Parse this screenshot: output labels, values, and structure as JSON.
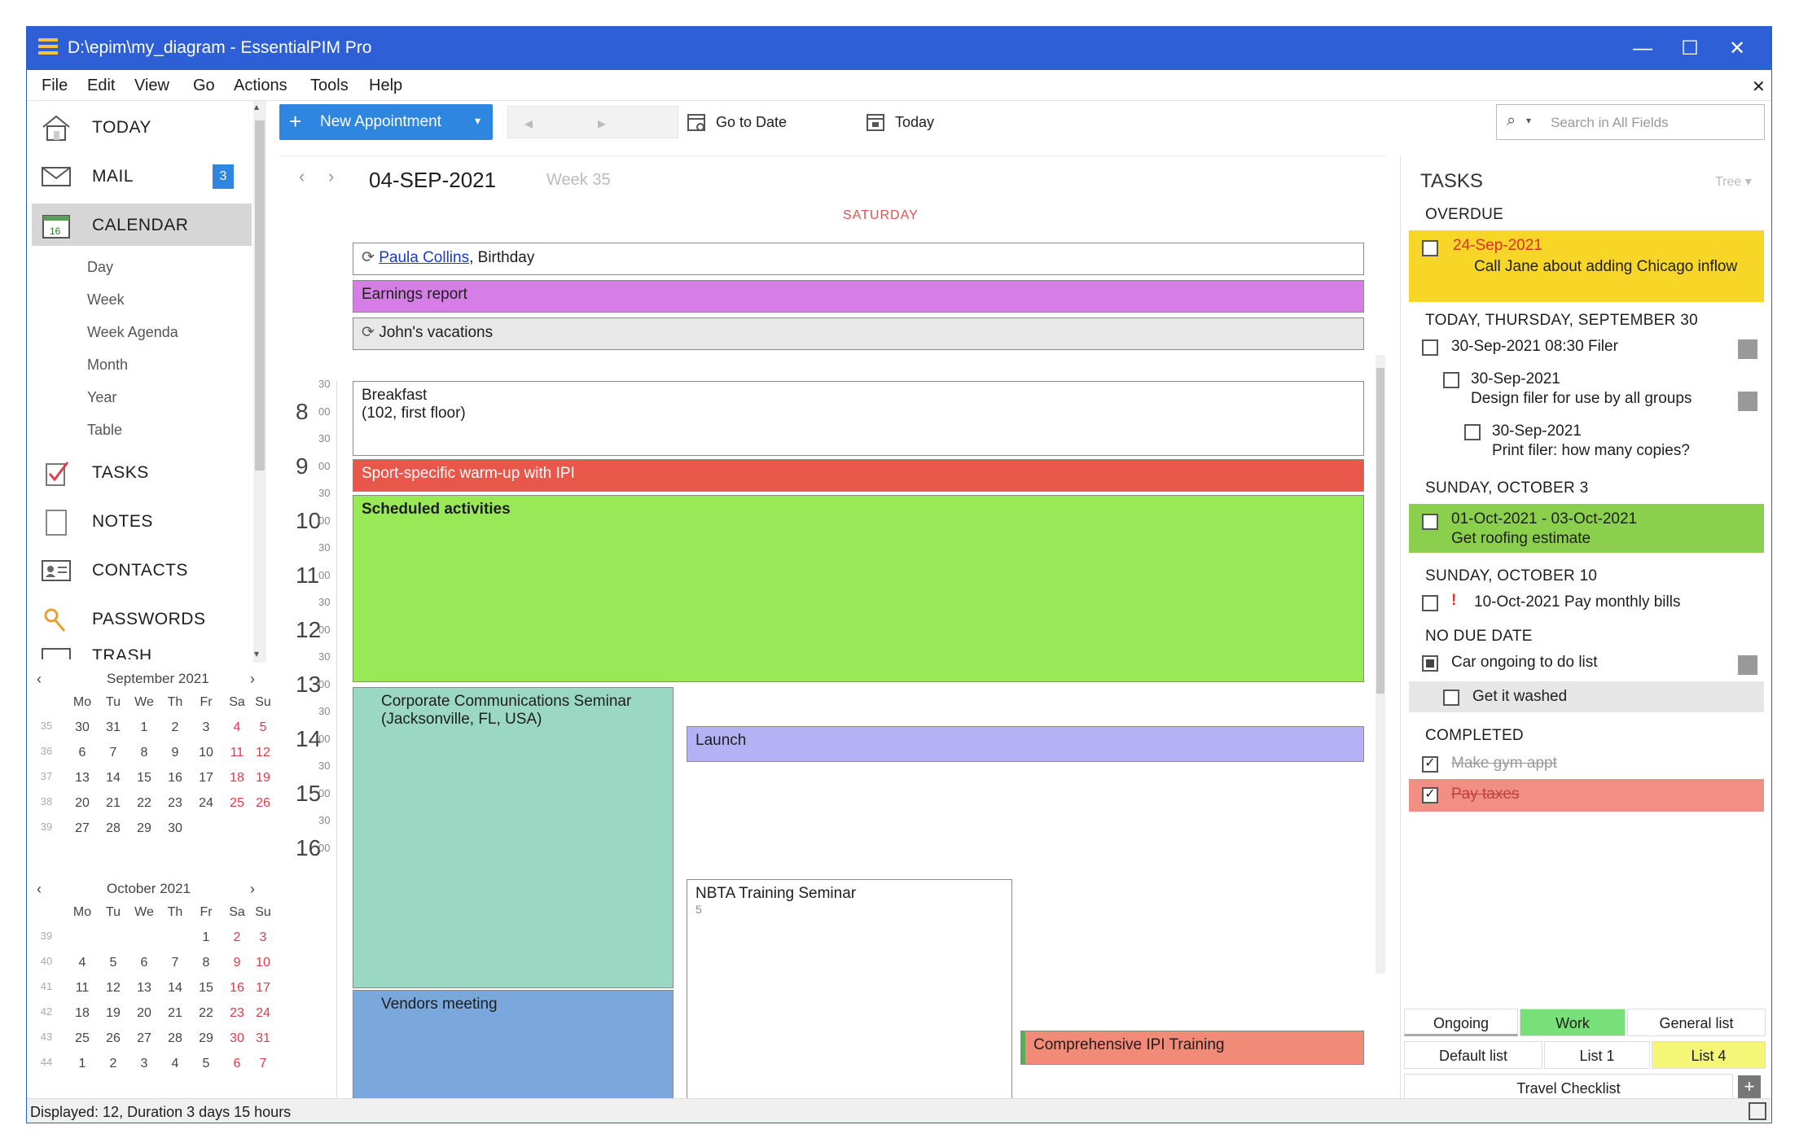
{
  "window": {
    "title": "D:\\epim\\my_diagram - EssentialPIM Pro",
    "min": "—",
    "max": "☐",
    "close": "✕"
  },
  "menu": {
    "file": "File",
    "edit": "Edit",
    "view": "View",
    "go": "Go",
    "actions": "Actions",
    "tools": "Tools",
    "help": "Help",
    "close": "✕"
  },
  "nav": {
    "today": "TODAY",
    "mail": "MAIL",
    "mail_badge": "3",
    "calendar": "CALENDAR",
    "sub": [
      "Day",
      "Week",
      "Week Agenda",
      "Month",
      "Year",
      "Table"
    ],
    "tasks": "TASKS",
    "notes": "NOTES",
    "contacts": "CONTACTS",
    "passwords": "PASSWORDS",
    "trash": "TRASH"
  },
  "minical1": {
    "title": "September 2021",
    "prev": "‹",
    "next": "›",
    "dow": [
      "Mo",
      "Tu",
      "We",
      "Th",
      "Fr",
      "Sa",
      "Su"
    ],
    "weeks": [
      "35",
      "36",
      "37",
      "38",
      "39"
    ],
    "rows": [
      [
        "30",
        "31",
        "1",
        "2",
        "3",
        "4",
        "5"
      ],
      [
        "6",
        "7",
        "8",
        "9",
        "10",
        "11",
        "12"
      ],
      [
        "13",
        "14",
        "15",
        "16",
        "17",
        "18",
        "19"
      ],
      [
        "20",
        "21",
        "22",
        "23",
        "24",
        "25",
        "26"
      ],
      [
        "27",
        "28",
        "29",
        "30",
        "",
        "",
        ""
      ]
    ]
  },
  "minical2": {
    "title": "October 2021",
    "prev": "‹",
    "next": "›",
    "dow": [
      "Mo",
      "Tu",
      "We",
      "Th",
      "Fr",
      "Sa",
      "Su"
    ],
    "weeks": [
      "39",
      "40",
      "41",
      "42",
      "43",
      "44"
    ],
    "rows": [
      [
        "",
        "",
        "",
        "",
        "1",
        "2",
        "3"
      ],
      [
        "4",
        "5",
        "6",
        "7",
        "8",
        "9",
        "10"
      ],
      [
        "11",
        "12",
        "13",
        "14",
        "15",
        "16",
        "17"
      ],
      [
        "18",
        "19",
        "20",
        "21",
        "22",
        "23",
        "24"
      ],
      [
        "25",
        "26",
        "27",
        "28",
        "29",
        "30",
        "31"
      ],
      [
        "1",
        "2",
        "3",
        "4",
        "5",
        "6",
        "7"
      ]
    ]
  },
  "toolbar": {
    "new_appointment": "New Appointment",
    "prev_icon": "◂",
    "next_icon": "▸",
    "go_to_date": "Go to Date",
    "today": "Today",
    "search_placeholder": "Search in All Fields"
  },
  "calendar": {
    "date": "04-SEP-2021",
    "week": "Week 35",
    "day_name": "SATURDAY",
    "all_day": [
      "Paula Collins",
      ", Birthday",
      "Earnings report",
      "John's vacations"
    ],
    "hours": [
      "8",
      "9",
      "10",
      "11",
      "12",
      "13",
      "14",
      "15",
      "16"
    ],
    "half_marks": [
      "30",
      "00"
    ],
    "events": {
      "breakfast_title": "Breakfast",
      "breakfast_loc": "(102, first floor)",
      "sport": "Sport-specific warm-up with IPI",
      "scheduled": "Scheduled activities",
      "corp_title": "Corporate Communications Seminar",
      "corp_loc": "(Jacksonville, FL, USA)",
      "lunch": "Launch",
      "nbta": "NBTA Training Seminar",
      "nbta_num": "5",
      "vendors": "Vendors meeting",
      "comp": "Comprehensive IPI Training"
    }
  },
  "tasks": {
    "title": "TASKS",
    "tree": "Tree ▾",
    "groups": [
      "OVERDUE",
      "TODAY, THURSDAY, SEPTEMBER 30",
      "SUNDAY, OCTOBER 3",
      "SUNDAY, OCTOBER 10",
      "NO DUE DATE",
      "COMPLETED"
    ],
    "overdue_date": "24-Sep-2021",
    "overdue_text": "Call Jane about adding Chicago inflow",
    "t1": "30-Sep-2021 08:30 Filer",
    "t2_date": "30-Sep-2021",
    "t2_text": "Design filer for use by all groups",
    "t3_date": "30-Sep-2021",
    "t3_text": "Print filer: how many copies?",
    "t4_date": "01-Oct-2021 - 03-Oct-2021",
    "t4_text": "Get roofing estimate",
    "t5_bang": "!",
    "t5": "10-Oct-2021 Pay monthly bills",
    "t6": "Car ongoing to do list",
    "t7": "Get it washed",
    "c1": "Make gym appt",
    "c2": "Pay taxes",
    "tabs_row1": [
      "Ongoing",
      "Work",
      "General list"
    ],
    "tabs_row2": [
      "Default list",
      "List 1",
      "List 4"
    ],
    "tabs_row3": "Travel Checklist",
    "add": "+"
  },
  "status": {
    "text": "Displayed: 12, Duration 3 days 15 hours"
  },
  "colors": {
    "titlebar": "#2f5fd6",
    "earnings": "#d57ee6",
    "sport": "#e8574a",
    "scheduled": "#98e858",
    "corp": "#9ad8c4",
    "vendors": "#7aa8dc",
    "lunch": "#b4b2f4",
    "comp": "#f28a78",
    "overdue": "#f7d627",
    "roof": "#8ad04c",
    "paytaxes": "#f28f84"
  }
}
